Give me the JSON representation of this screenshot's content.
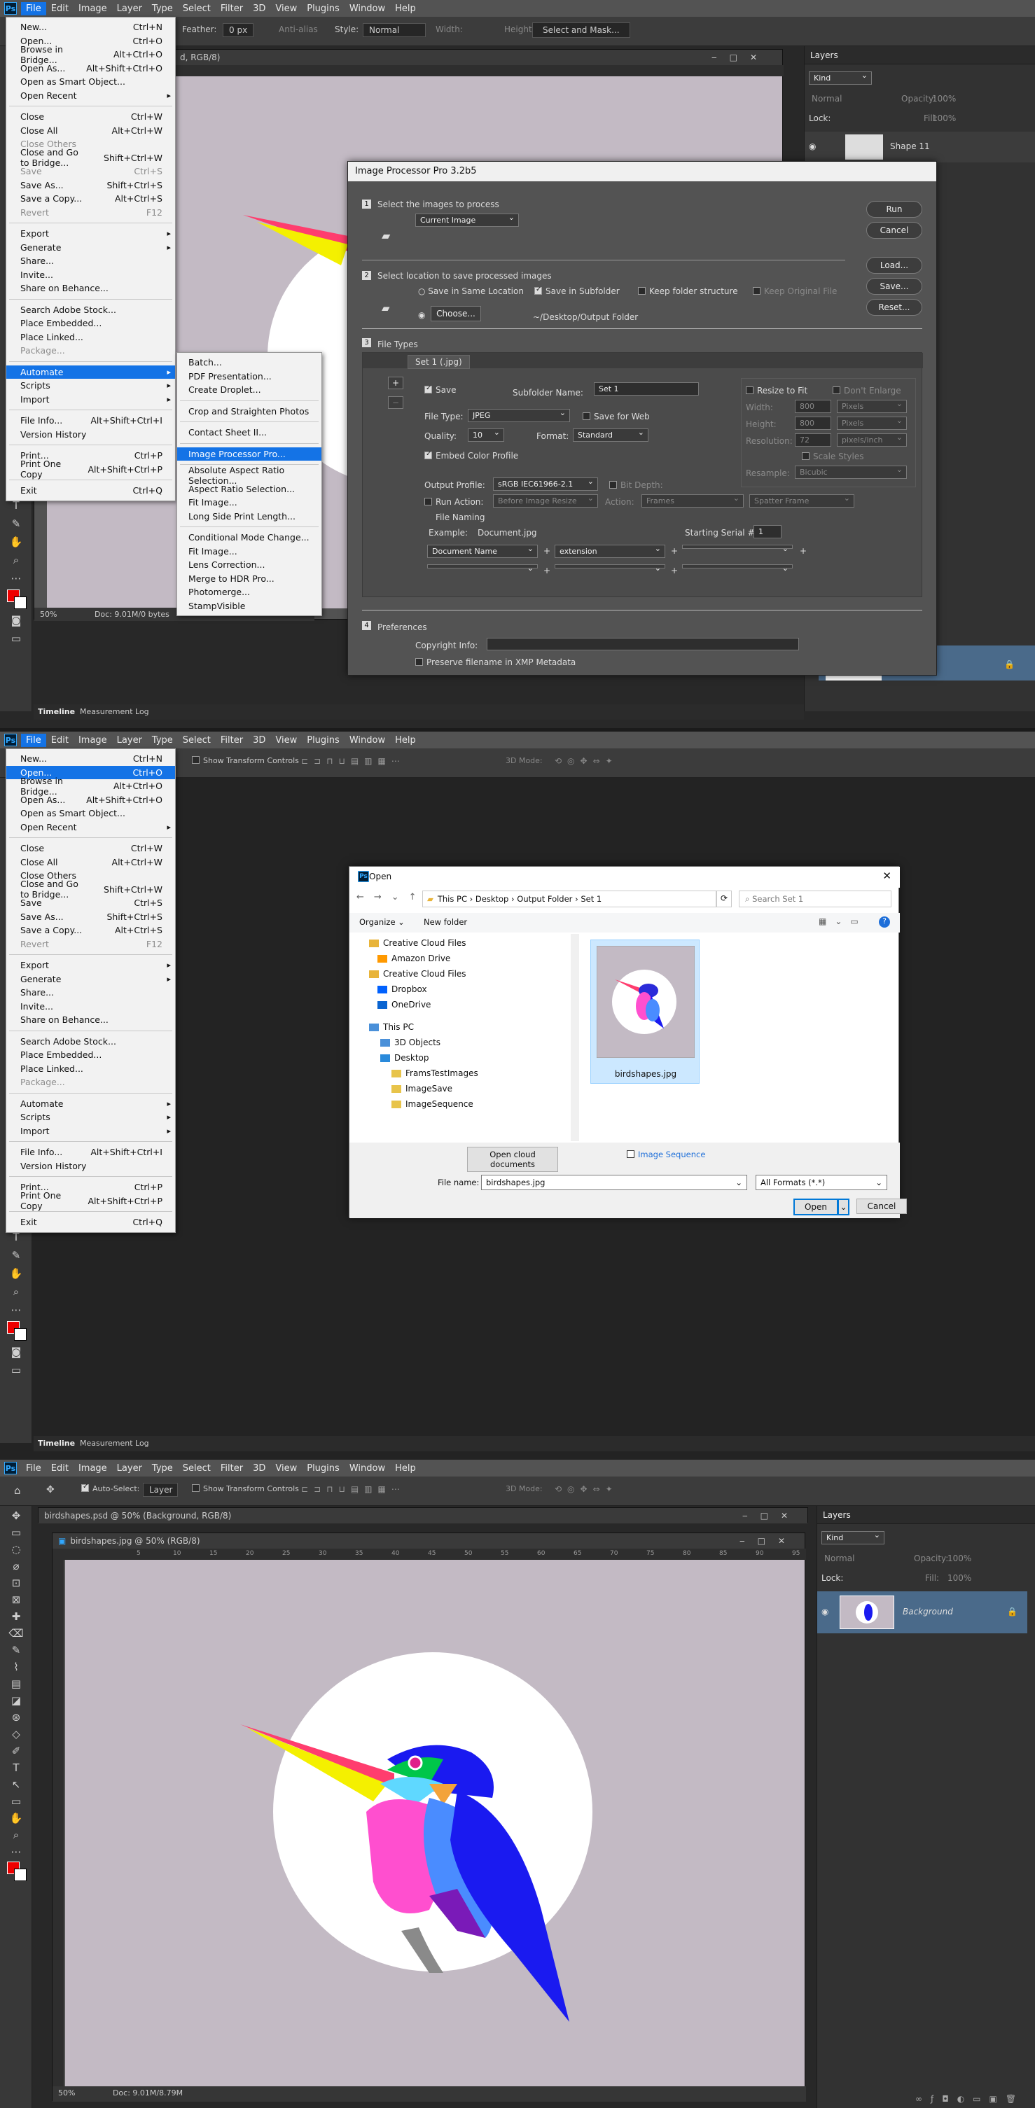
{
  "menubar": {
    "logo": "Ps",
    "items": [
      "File",
      "Edit",
      "Image",
      "Layer",
      "Type",
      "Select",
      "Filter",
      "3D",
      "View",
      "Plugins",
      "Window",
      "Help"
    ]
  },
  "file_menu": [
    {
      "label": "New...",
      "shortcut": "Ctrl+N"
    },
    {
      "label": "Open...",
      "shortcut": "Ctrl+O"
    },
    {
      "label": "Browse in Bridge...",
      "shortcut": "Alt+Ctrl+O"
    },
    {
      "label": "Open As...",
      "shortcut": "Alt+Shift+Ctrl+O"
    },
    {
      "label": "Open as Smart Object...",
      "shortcut": ""
    },
    {
      "label": "Open Recent",
      "shortcut": "",
      "sub": true
    },
    {
      "sep": true
    },
    {
      "label": "Close",
      "shortcut": "Ctrl+W"
    },
    {
      "label": "Close All",
      "shortcut": "Alt+Ctrl+W"
    },
    {
      "label": "Close Others",
      "shortcut": "",
      "dis_p1": true
    },
    {
      "label": "Close and Go to Bridge...",
      "shortcut": "Shift+Ctrl+W"
    },
    {
      "label": "Save",
      "shortcut": "Ctrl+S",
      "dis_p1": true
    },
    {
      "label": "Save As...",
      "shortcut": "Shift+Ctrl+S"
    },
    {
      "label": "Save a Copy...",
      "shortcut": "Alt+Ctrl+S"
    },
    {
      "label": "Revert",
      "shortcut": "F12",
      "dis": true
    },
    {
      "sep": true
    },
    {
      "label": "Export",
      "shortcut": "",
      "sub": true
    },
    {
      "label": "Generate",
      "shortcut": "",
      "sub": true
    },
    {
      "label": "Share...",
      "shortcut": ""
    },
    {
      "label": "Invite...",
      "shortcut": ""
    },
    {
      "label": "Share on Behance...",
      "shortcut": ""
    },
    {
      "sep": true
    },
    {
      "label": "Search Adobe Stock...",
      "shortcut": ""
    },
    {
      "label": "Place Embedded...",
      "shortcut": ""
    },
    {
      "label": "Place Linked...",
      "shortcut": ""
    },
    {
      "label": "Package...",
      "shortcut": "",
      "dis": true
    },
    {
      "sep": true
    },
    {
      "label": "Automate",
      "shortcut": "",
      "sub": true,
      "hi_p1": true
    },
    {
      "label": "Scripts",
      "shortcut": "",
      "sub": true
    },
    {
      "label": "Import",
      "shortcut": "",
      "sub": true
    },
    {
      "sep": true
    },
    {
      "label": "File Info...",
      "shortcut": "Alt+Shift+Ctrl+I"
    },
    {
      "label": "Version History",
      "shortcut": ""
    },
    {
      "sep": true
    },
    {
      "label": "Print...",
      "shortcut": "Ctrl+P"
    },
    {
      "label": "Print One Copy",
      "shortcut": "Alt+Shift+Ctrl+P"
    },
    {
      "sep": true
    },
    {
      "label": "Exit",
      "shortcut": "Ctrl+Q"
    }
  ],
  "automate_menu": [
    {
      "label": "Batch..."
    },
    {
      "label": "PDF Presentation..."
    },
    {
      "label": "Create Droplet..."
    },
    {
      "sep": true
    },
    {
      "label": "Crop and Straighten Photos"
    },
    {
      "sep": true
    },
    {
      "label": "Contact Sheet II..."
    },
    {
      "sep": true
    },
    {
      "label": "Image Processor Pro...",
      "hi": true
    },
    {
      "sep": true
    },
    {
      "label": "Absolute Aspect Ratio Selection..."
    },
    {
      "label": "Aspect Ratio Selection..."
    },
    {
      "label": "Fit Image..."
    },
    {
      "label": "Long Side Print Length..."
    },
    {
      "sep": true
    },
    {
      "label": "Conditional Mode Change..."
    },
    {
      "label": "Fit Image..."
    },
    {
      "label": "Lens Correction..."
    },
    {
      "label": "Merge to HDR Pro..."
    },
    {
      "label": "Photomerge..."
    },
    {
      "label": "StampVisible"
    }
  ],
  "p1": {
    "optbar": {
      "feather_label": "Feather:",
      "feather_value": "0 px",
      "anti_alias": "Anti-alias",
      "style_label": "Style:",
      "style_value": "Normal",
      "width_label": "Width:",
      "height_label": "Height:",
      "select_mask": "Select and Mask..."
    },
    "doc_title": "d, RGB/8)",
    "status": {
      "zoom": "50%",
      "doc": "Doc: 9.01M/0 bytes"
    },
    "layers_title": "Layers",
    "layer_name": "Shape 11",
    "kind": "Kind",
    "normal": "Normal",
    "opacity": "Opacity:",
    "opacity_val": "100%",
    "lock": "Lock:",
    "fill": "Fill:",
    "fill_val": "100%"
  },
  "ipp": {
    "title": "Image Processor Pro 3.2b5",
    "s1": "Select the images to process",
    "s1_sel": "Current Image",
    "run": "Run",
    "cancel": "Cancel",
    "load": "Load...",
    "save": "Save...",
    "reset": "Reset...",
    "s2": "Select location to save processed images",
    "same_folder": "Save in Same Location",
    "subfolder": "Save in Subfolder",
    "keep_structure": "Keep folder structure",
    "keep_original": "Keep Original File",
    "choose": "Choose...",
    "path": "~/Desktop/Output Folder",
    "s3": "File Types",
    "tab": "Set 1 (.jpg)",
    "save_cb": "Save",
    "subfolder_name_label": "Subfolder Name:",
    "subfolder_name": "Set 1",
    "file_type_label": "File Type:",
    "file_type": "JPEG",
    "save_web": "Save for Web",
    "quality_label": "Quality:",
    "quality": "10",
    "format_label": "Format:",
    "format": "Standard",
    "embed_profile": "Embed Color Profile",
    "output_profile_label": "Output Profile:",
    "output_profile": "sRGB IEC61966-2.1",
    "bit_depth": "Bit Depth:",
    "run_action": "Run Action:",
    "before_resize": "Before Image Resize",
    "action_label": "Action:",
    "action_set": "Frames",
    "action_name": "Spatter Frame",
    "file_naming": "File Naming",
    "example_label": "Example:",
    "example": "Document.jpg",
    "serial_label": "Starting Serial #:",
    "serial": "1",
    "name1": "Document Name",
    "name2": "extension",
    "resize": "Resize to Fit",
    "dont_enlarge": "Don't Enlarge",
    "width": "Width:",
    "height": "Height:",
    "resolution": "Resolution:",
    "w_val": "800",
    "h_val": "800",
    "r_val": "72",
    "pixels": "Pixels",
    "pixels_inch": "pixels/inch",
    "scale_styles": "Scale Styles",
    "resample": "Resample:",
    "bicubic": "Bicubic",
    "s4": "Preferences",
    "copyright": "Copyright Info:",
    "preserve": "Preserve filename in XMP Metadata"
  },
  "p2": {
    "optbar": {
      "show_transform": "Show Transform Controls",
      "mode3d": "3D Mode:"
    },
    "open_dialog": {
      "title": "Open",
      "breadcrumb": [
        "This PC",
        "Desktop",
        "Output Folder",
        "Set 1"
      ],
      "search": "Search Set 1",
      "organize": "Organize",
      "new_folder": "New folder",
      "nav": [
        "Creative Cloud Files",
        "Amazon Drive",
        "Creative Cloud Files",
        "Dropbox",
        "OneDrive",
        "This PC",
        "3D Objects",
        "Desktop",
        "FramsTestImages",
        "ImageSave",
        "ImageSequence"
      ],
      "file": "birdshapes.jpg",
      "open_cloud": "Open cloud documents",
      "image_sequence": "Image Sequence",
      "file_name_label": "File name:",
      "file_name": "birdshapes.jpg",
      "formats": "All Formats (*.*)",
      "open": "Open",
      "cancel": "Cancel"
    }
  },
  "p3": {
    "optbar": {
      "auto_select": "Auto-Select:",
      "layer": "Layer",
      "show_transform": "Show Transform Controls",
      "mode3d": "3D Mode:"
    },
    "doc1": "birdshapes.psd @ 50% (Background, RGB/8)",
    "doc2": "birdshapes.jpg @ 50% (RGB/8)",
    "status": {
      "zoom": "50%",
      "doc": "Doc: 9.01M/8.79M"
    },
    "layers_title": "Layers",
    "kind": "Kind",
    "normal": "Normal",
    "opacity": "Opacity:",
    "opacity_val": "100%",
    "lock": "Lock:",
    "fill": "Fill:",
    "fill_val": "100%",
    "layer_name": "Background"
  },
  "timeline": {
    "tab1": "Timeline",
    "tab2": "Measurement Log"
  },
  "ruler_ticks": [
    "5",
    "10",
    "15",
    "20",
    "25",
    "30",
    "35",
    "40",
    "45",
    "50",
    "55",
    "60",
    "65",
    "70",
    "75",
    "80",
    "85",
    "90",
    "95"
  ],
  "colors": {
    "ps_blue": "#1473e6",
    "canvas": "#c3bac4"
  }
}
